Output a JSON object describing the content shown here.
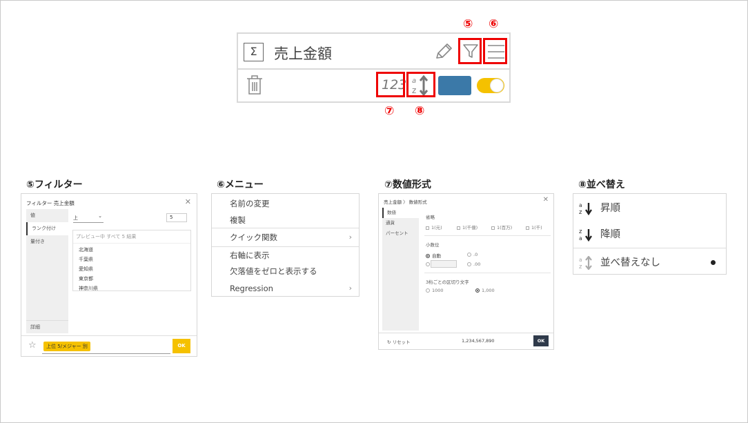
{
  "card": {
    "sigma": "Σ",
    "title": "売上金額",
    "format_label": "123",
    "swatch_color": "#3b79a8",
    "toggle_color": "#f5c100",
    "callouts": {
      "n5": "⑤",
      "n6": "⑥",
      "n7": "⑦",
      "n8": "⑧"
    },
    "icons": [
      "sigma-icon",
      "pencil-icon",
      "filter-icon",
      "menu-icon",
      "trash-icon",
      "number-format-icon",
      "sort-icon",
      "color-swatch",
      "toggle"
    ]
  },
  "sections": {
    "filter": "⑤フィルター",
    "menu": "⑥メニュー",
    "format": "⑦数値形式",
    "sort": "⑧並べ替え"
  },
  "filter_panel": {
    "header": "フィルター 売上金額",
    "close": "✕",
    "tabs": [
      "値",
      "ランク付け",
      "量付き"
    ],
    "detail": "詳細",
    "direction": "上",
    "direction_caret": "⌄",
    "count": "5",
    "preview": "プレビュー中 すべて 5 結果",
    "items": [
      "北海道",
      "千葉県",
      "愛知県",
      "東京都",
      "神奈川県"
    ],
    "star": "☆",
    "chip": "上位 5/メジャー 別",
    "ok": "OK"
  },
  "menu_panel": {
    "items": [
      "名前の変更",
      "複製",
      "クイック関数",
      "右軸に表示",
      "欠落値をゼロと表示する",
      "Regression"
    ],
    "chevron": "›"
  },
  "format_panel": {
    "breadcrumb": "売上金額 〉 数値形式",
    "close": "✕",
    "tabs": [
      "数値",
      "通貨",
      "パーセント"
    ],
    "abbrev_label": "省略",
    "abbrev_options": [
      "1(元)",
      "1(千億)",
      "1(百万)",
      "1(千)"
    ],
    "decimal_label": "小数位",
    "decimal_auto": "自動",
    "decimal_one": ".0",
    "decimal_two": ".00",
    "separator_label": "3桁ごとの区切り文字",
    "sep_options": [
      "1000",
      "1,000"
    ],
    "reset": "↻ リセット",
    "preview_value": "1,234,567,890",
    "ok": "OK"
  },
  "sort_panel": {
    "asc": "昇順",
    "desc": "降順",
    "none": "並べ替えなし",
    "selected": "none"
  },
  "colors": {
    "accent_red": "#ee0000",
    "yellow": "#f5c100",
    "dark_button": "#2f3a4a"
  }
}
